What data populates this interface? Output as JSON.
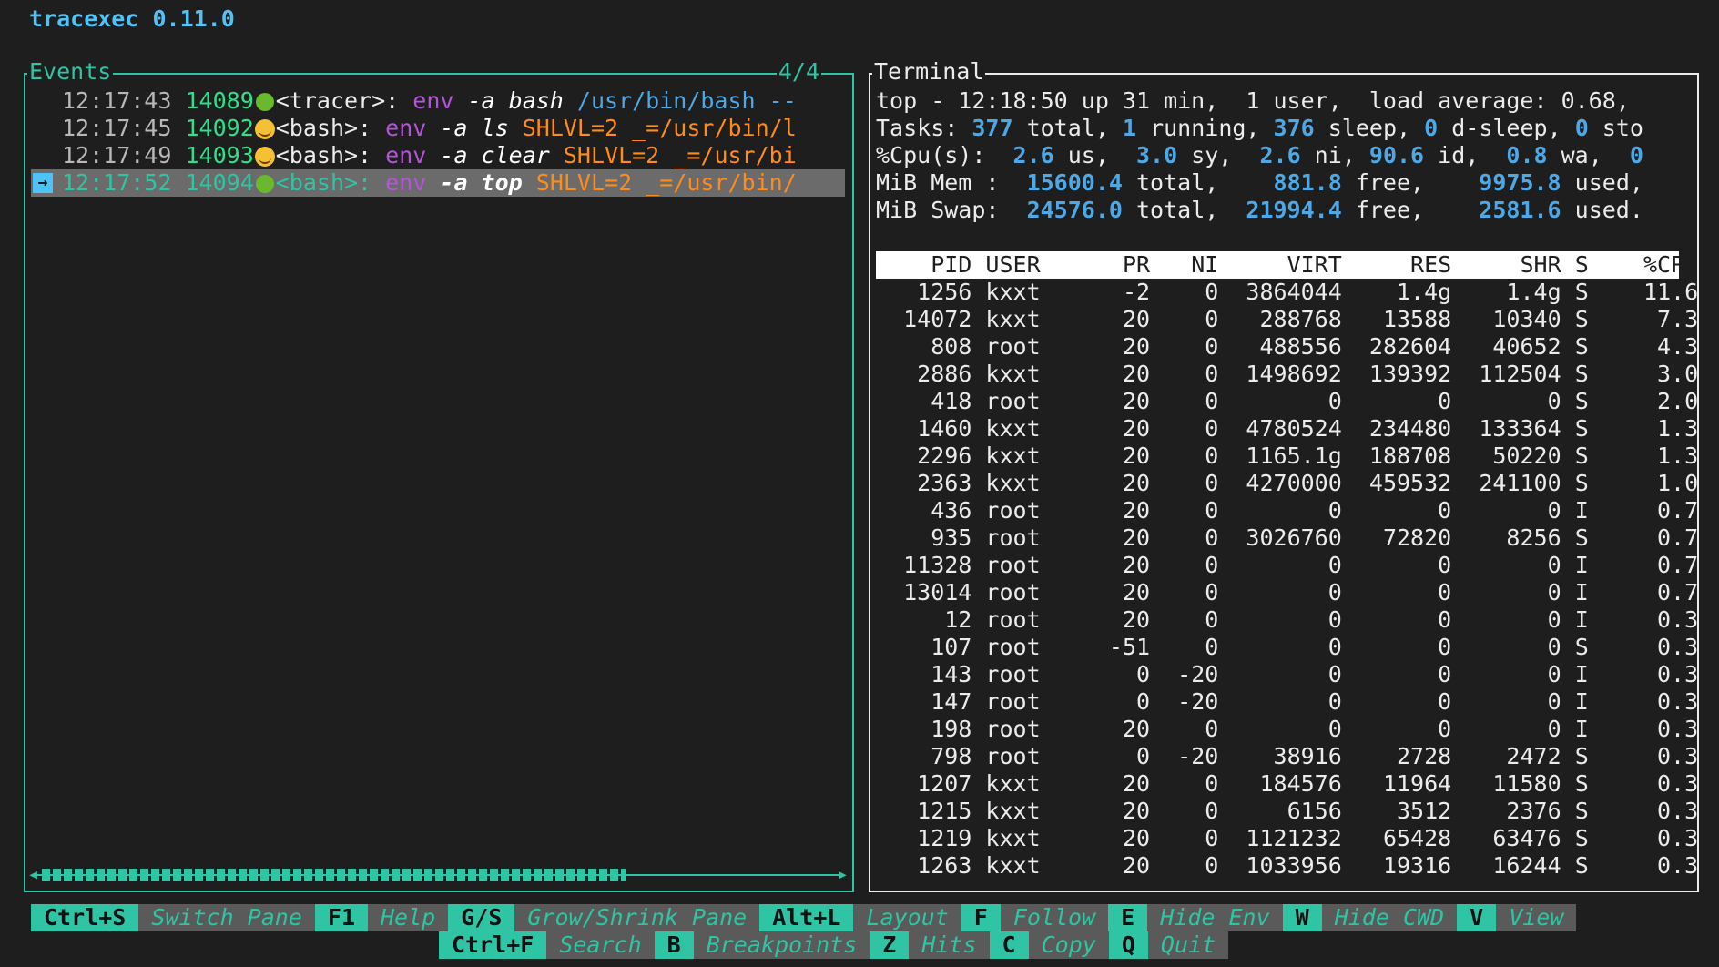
{
  "app": {
    "title": "tracexec 0.11.0"
  },
  "events": {
    "title": "Events",
    "count": "4/4",
    "rows": [
      {
        "time": "12:17:43",
        "pid": "14089",
        "status": "green-dot",
        "comm": "<tracer>:",
        "cmd": "env",
        "args": "-a bash",
        "tail": "/usr/bin/bash --",
        "tail_kind": "path"
      },
      {
        "time": "12:17:45",
        "pid": "14092",
        "status": "smile-face",
        "comm": "<bash>:",
        "cmd": "env",
        "args": "-a ls",
        "tail": "SHLVL=2 _=/usr/bin/l",
        "tail_kind": "envvar"
      },
      {
        "time": "12:17:49",
        "pid": "14093",
        "status": "smile-face",
        "comm": "<bash>:",
        "cmd": "env",
        "args": "-a clear",
        "tail": "SHLVL=2 _=/usr/bi",
        "tail_kind": "envvar"
      },
      {
        "time": "12:17:52",
        "pid": "14094",
        "status": "green-dot",
        "comm": "<bash>:",
        "cmd": "env",
        "args": "-a top",
        "tail": "SHLVL=2 _=/usr/bin/",
        "tail_kind": "envvar",
        "selected": true
      }
    ],
    "selected_arrow": "→"
  },
  "terminal": {
    "title": "Terminal",
    "top_line": "top - 12:18:50 up 31 min,  1 user,  load average: 0.68,",
    "tasks": {
      "label": "Tasks:",
      "total": "377",
      "running": "1",
      "sleep": "376",
      "dsleep": "0",
      "stopped": "0"
    },
    "cpu": {
      "label": "%Cpu(s):",
      "us": "2.6",
      "sy": "3.0",
      "ni": "2.6",
      "id": "90.6",
      "wa": "0.8",
      "hi": "0"
    },
    "mem": {
      "label": "MiB Mem :",
      "total": "15600.4",
      "free": "881.8",
      "used": "9975.8"
    },
    "swap": {
      "label": "MiB Swap:",
      "total": "24576.0",
      "free": "21994.4",
      "used": "2581.6"
    },
    "header": [
      "PID",
      "USER",
      "PR",
      "NI",
      "VIRT",
      "RES",
      "SHR",
      "S",
      "%CPU"
    ],
    "processes": [
      [
        "1256",
        "kxxt",
        "-2",
        "0",
        "3864044",
        "1.4g",
        "1.4g",
        "S",
        "11.6"
      ],
      [
        "14072",
        "kxxt",
        "20",
        "0",
        "288768",
        "13588",
        "10340",
        "S",
        "7.3"
      ],
      [
        "808",
        "root",
        "20",
        "0",
        "488556",
        "282604",
        "40652",
        "S",
        "4.3"
      ],
      [
        "2886",
        "kxxt",
        "20",
        "0",
        "1498692",
        "139392",
        "112504",
        "S",
        "3.0"
      ],
      [
        "418",
        "root",
        "20",
        "0",
        "0",
        "0",
        "0",
        "S",
        "2.0"
      ],
      [
        "1460",
        "kxxt",
        "20",
        "0",
        "4780524",
        "234480",
        "133364",
        "S",
        "1.3"
      ],
      [
        "2296",
        "kxxt",
        "20",
        "0",
        "1165.1g",
        "188708",
        "50220",
        "S",
        "1.3"
      ],
      [
        "2363",
        "kxxt",
        "20",
        "0",
        "4270000",
        "459532",
        "241100",
        "S",
        "1.0"
      ],
      [
        "436",
        "root",
        "20",
        "0",
        "0",
        "0",
        "0",
        "I",
        "0.7"
      ],
      [
        "935",
        "root",
        "20",
        "0",
        "3026760",
        "72820",
        "8256",
        "S",
        "0.7"
      ],
      [
        "11328",
        "root",
        "20",
        "0",
        "0",
        "0",
        "0",
        "I",
        "0.7"
      ],
      [
        "13014",
        "root",
        "20",
        "0",
        "0",
        "0",
        "0",
        "I",
        "0.7"
      ],
      [
        "12",
        "root",
        "20",
        "0",
        "0",
        "0",
        "0",
        "I",
        "0.3"
      ],
      [
        "107",
        "root",
        "-51",
        "0",
        "0",
        "0",
        "0",
        "S",
        "0.3"
      ],
      [
        "143",
        "root",
        "0",
        "-20",
        "0",
        "0",
        "0",
        "I",
        "0.3"
      ],
      [
        "147",
        "root",
        "0",
        "-20",
        "0",
        "0",
        "0",
        "I",
        "0.3"
      ],
      [
        "198",
        "root",
        "20",
        "0",
        "0",
        "0",
        "0",
        "I",
        "0.3"
      ],
      [
        "798",
        "root",
        "0",
        "-20",
        "38916",
        "2728",
        "2472",
        "S",
        "0.3"
      ],
      [
        "1207",
        "kxxt",
        "20",
        "0",
        "184576",
        "11964",
        "11580",
        "S",
        "0.3"
      ],
      [
        "1215",
        "kxxt",
        "20",
        "0",
        "6156",
        "3512",
        "2376",
        "S",
        "0.3"
      ],
      [
        "1219",
        "kxxt",
        "20",
        "0",
        "1121232",
        "65428",
        "63476",
        "S",
        "0.3"
      ],
      [
        "1263",
        "kxxt",
        "20",
        "0",
        "1033956",
        "19316",
        "16244",
        "S",
        "0.3"
      ]
    ]
  },
  "footer": {
    "row1": [
      {
        "key": "Ctrl+S",
        "label": "Switch Pane"
      },
      {
        "key": "F1",
        "label": "Help"
      },
      {
        "key": "G/S",
        "label": "Grow/Shrink Pane"
      },
      {
        "key": "Alt+L",
        "label": "Layout"
      },
      {
        "key": "F",
        "label": "Follow"
      },
      {
        "key": "E",
        "label": "Hide Env"
      },
      {
        "key": "W",
        "label": "Hide CWD"
      },
      {
        "key": "V",
        "label": "View"
      }
    ],
    "row2": [
      {
        "key": "Ctrl+F",
        "label": "Search"
      },
      {
        "key": "B",
        "label": "Breakpoints"
      },
      {
        "key": "Z",
        "label": "Hits"
      },
      {
        "key": "C",
        "label": "Copy"
      },
      {
        "key": "Q",
        "label": "Quit"
      }
    ]
  },
  "colors": {
    "accent": "#2ec4a4",
    "background": "#1e1e1e",
    "number_blue": "#4fa8e6",
    "env_purple": "#b455d9",
    "envvar_orange": "#ff8c1a",
    "pid_green": "#2ee08a"
  }
}
